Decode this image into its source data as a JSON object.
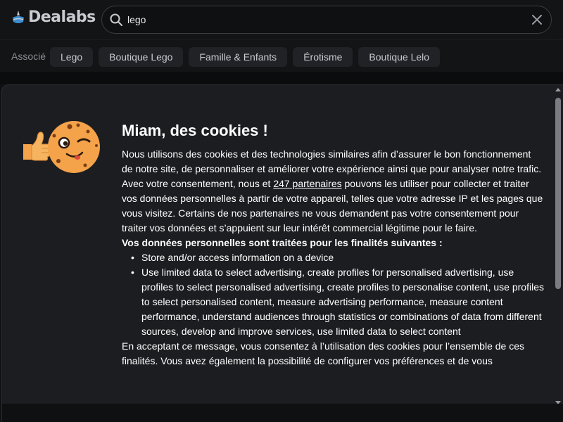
{
  "header": {
    "logo_text": "Dealabs",
    "search": {
      "value": "lego",
      "placeholder": ""
    }
  },
  "associated": {
    "label": "Associé",
    "chips": [
      {
        "label": "Lego"
      },
      {
        "label": "Boutique Lego"
      },
      {
        "label": "Famille & Enfants"
      },
      {
        "label": "Érotisme"
      },
      {
        "label": "Boutique Lelo"
      }
    ]
  },
  "cookie_modal": {
    "title": "Miam, des cookies !",
    "intro_before_link": "Nous utilisons des cookies et des technologies similaires afin d’assurer le bon fonctionnement de notre site, de personnaliser et améliorer votre expérience ainsi que pour analyser notre trafic. Avec votre consentement, nous et ",
    "partners_link": "247 partenaires",
    "intro_after_link": " pouvons les utiliser pour collecter et traiter vos données personnelles à partir de votre appareil, telles que votre adresse IP et les pages que vous visitez. Certains de nos partenaires ne vous demandent pas votre consentement pour traiter vos données et s’appuient sur leur intérêt commercial légitime pour le faire.",
    "purposes_title": "Vos données personnelles sont traitées pour les finalités suivantes :",
    "purposes": [
      "Store and/or access information on a device",
      "Use limited data to select advertising, create profiles for personalised advertising, use profiles to select personalised advertising, create profiles to personalise content, use profiles to select personalised content, measure advertising performance, measure content performance, understand audiences through statistics or combinations of data from different sources, develop and improve services, use limited data to select content"
    ],
    "consent_text": "En acceptant ce message, vous consentez à l’utilisation des cookies pour l’ensemble de ces finalités. Vous avez également la possibilité de configurer vos préférences et de vous"
  },
  "icons": {
    "search": "search-icon",
    "clear": "close-icon",
    "thumbs_up": "thumbs-up-icon",
    "cookie": "winking-cookie-icon"
  },
  "colors": {
    "background": "#0f1012",
    "modal": "#1c1d21",
    "chip": "#212226",
    "cookie": "#f5a34a",
    "logo": "#c9cbd1"
  }
}
